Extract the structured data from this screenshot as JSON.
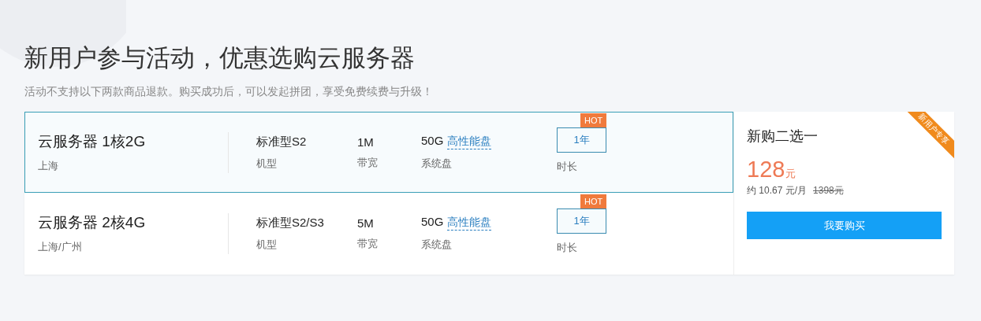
{
  "heading": "新用户参与活动，优惠选购云服务器",
  "notice": "活动不支持以下两款商品退款。购买成功后，可以发起拼团，享受免费续费与升级！",
  "plans": [
    {
      "name": "云服务器 1核2G",
      "region": "上海",
      "model": "标准型S2",
      "model_label": "机型",
      "bandwidth": "1M",
      "bandwidth_label": "带宽",
      "disk": "50G",
      "disk_type": "高性能盘",
      "disk_label": "系统盘",
      "duration": "1年",
      "badge": "HOT",
      "duration_label": "时长",
      "selected": true
    },
    {
      "name": "云服务器 2核4G",
      "region": "上海/广州",
      "model": "标准型S2/S3",
      "model_label": "机型",
      "bandwidth": "5M",
      "bandwidth_label": "带宽",
      "disk": "50G",
      "disk_type": "高性能盘",
      "disk_label": "系统盘",
      "duration": "1年",
      "badge": "HOT",
      "duration_label": "时长",
      "selected": false
    }
  ],
  "offer": {
    "title": "新购二选一",
    "ribbon": "新用户专享",
    "price": "128",
    "price_unit": "元",
    "monthly": "约 10.67 元/月",
    "original_price": "1398元",
    "button": "我要购买"
  }
}
